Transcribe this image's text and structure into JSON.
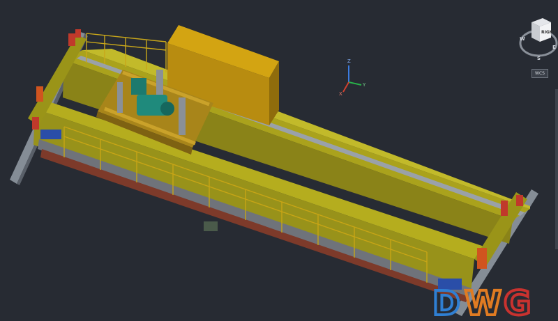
{
  "viewport": {
    "background": "#272b33",
    "colors": {
      "girder": "#a9a21a",
      "girder_dark": "#7c7612",
      "cab": "#c79912",
      "trolley": "#b08a14",
      "motor": "#1f8a7c",
      "rail": "#7f8791",
      "red_part": "#c0392b",
      "walkway": "#6b6f76"
    }
  },
  "viewcube": {
    "face_label": "RIGHT",
    "compass": {
      "south": "S",
      "east": "E",
      "west": "W"
    },
    "coordinate_system": "WCS"
  },
  "ucs_icon": {
    "x_label": "X",
    "y_label": "Y",
    "z_label": "Z"
  },
  "watermark": {
    "letters": [
      "D",
      "W",
      "G"
    ],
    "colors": [
      "#2f7fd3",
      "#e07b22",
      "#c9322f"
    ]
  }
}
